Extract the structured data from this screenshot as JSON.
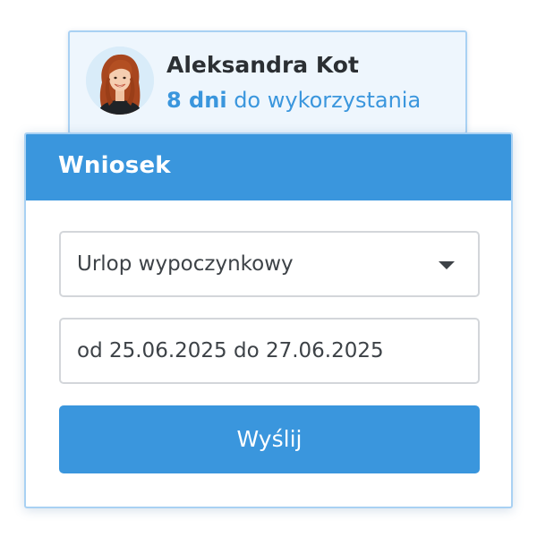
{
  "employee": {
    "name": "Aleksandra Kot",
    "days_value": "8 dni",
    "days_suffix": "do wykorzystania",
    "avatar_icon": "person-photo"
  },
  "request": {
    "title": "Wniosek",
    "leave_type": {
      "selected": "Urlop wypoczynkowy",
      "icon": "chevron-down-icon"
    },
    "date_range": {
      "value": "od 25.06.2025 do 27.06.2025"
    },
    "submit_label": "Wyślij"
  },
  "colors": {
    "accent": "#3a96dd",
    "card_background": "#eef6fd",
    "border": "#a9d1f3",
    "text": "#2b2f33"
  }
}
